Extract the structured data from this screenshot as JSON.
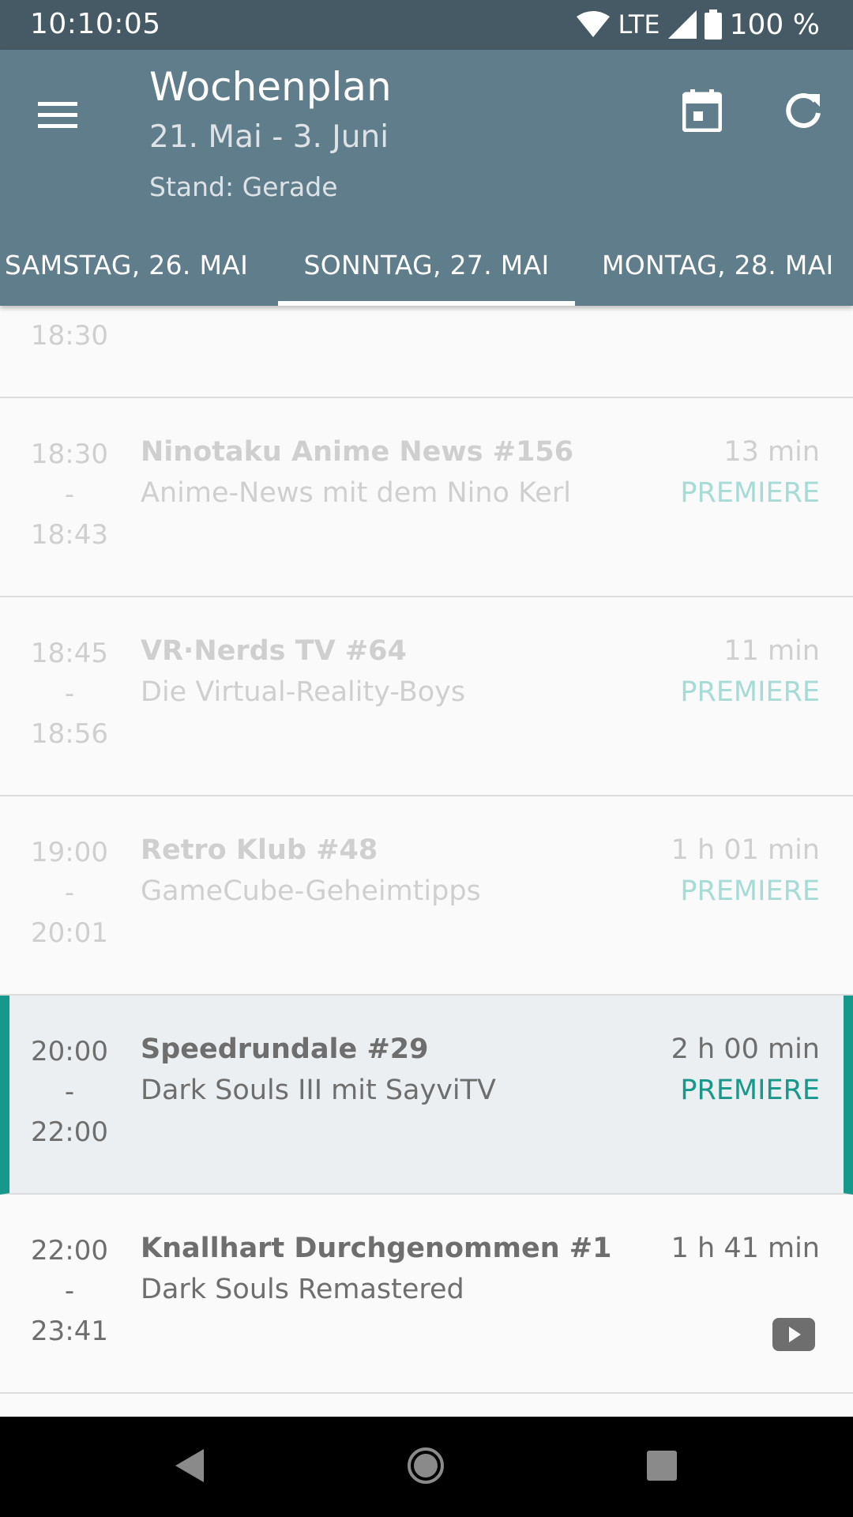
{
  "status_bar": {
    "time": "10:10:05",
    "network": "LTE",
    "battery": "100 %",
    "icons": [
      "wifi-icon",
      "signal-icon",
      "battery-icon"
    ]
  },
  "app_bar": {
    "title": "Wochenplan",
    "subtitle": "21. Mai - 3. Juni",
    "stand": "Stand: Gerade",
    "icons": [
      "menu-icon",
      "calendar-icon",
      "refresh-icon"
    ]
  },
  "tabs": [
    {
      "label": "SAMSTAG, 26. MAI"
    },
    {
      "label": "SONNTAG, 27. MAI",
      "selected": true
    },
    {
      "label": "MONTAG, 28. MAI"
    }
  ],
  "schedule": [
    {
      "start": "",
      "sep": "",
      "end": "18:30",
      "title": "",
      "subtitle": "",
      "duration": "",
      "tag": "",
      "state": "past"
    },
    {
      "start": "18:30",
      "sep": "-",
      "end": "18:43",
      "title": "Ninotaku Anime News #156",
      "subtitle": "Anime-News mit dem Nino Kerl",
      "duration": "13 min",
      "tag": "PREMIERE",
      "state": "past"
    },
    {
      "start": "18:45",
      "sep": "-",
      "end": "18:56",
      "title": "VR·Nerds TV #64",
      "subtitle": "Die Virtual-Reality-Boys",
      "duration": "11 min",
      "tag": "PREMIERE",
      "state": "past"
    },
    {
      "start": "19:00",
      "sep": "-",
      "end": "20:01",
      "title": "Retro Klub #48",
      "subtitle": "GameCube-Geheimtipps",
      "duration": "1 h 01 min",
      "tag": "PREMIERE",
      "state": "past"
    },
    {
      "start": "20:00",
      "sep": "-",
      "end": "22:00",
      "title": "Speedrundale #29",
      "subtitle": "Dark Souls III mit SayviTV",
      "duration": "2 h 00 min",
      "tag": "PREMIERE",
      "state": "current"
    },
    {
      "start": "22:00",
      "sep": "-",
      "end": "23:41",
      "title": "Knallhart Durchgenommen #1",
      "subtitle": "Dark Souls Remastered",
      "duration": "1 h 41 min",
      "tag": "",
      "icon": "youtube-icon",
      "state": "upcoming"
    }
  ],
  "colors": {
    "status_bar": "#455a64",
    "app_bar": "#607d8b",
    "accent": "#16998a",
    "current_bg": "#eceff1"
  },
  "nav_bar": {
    "icons": [
      "back-icon",
      "home-icon",
      "recents-icon"
    ]
  }
}
